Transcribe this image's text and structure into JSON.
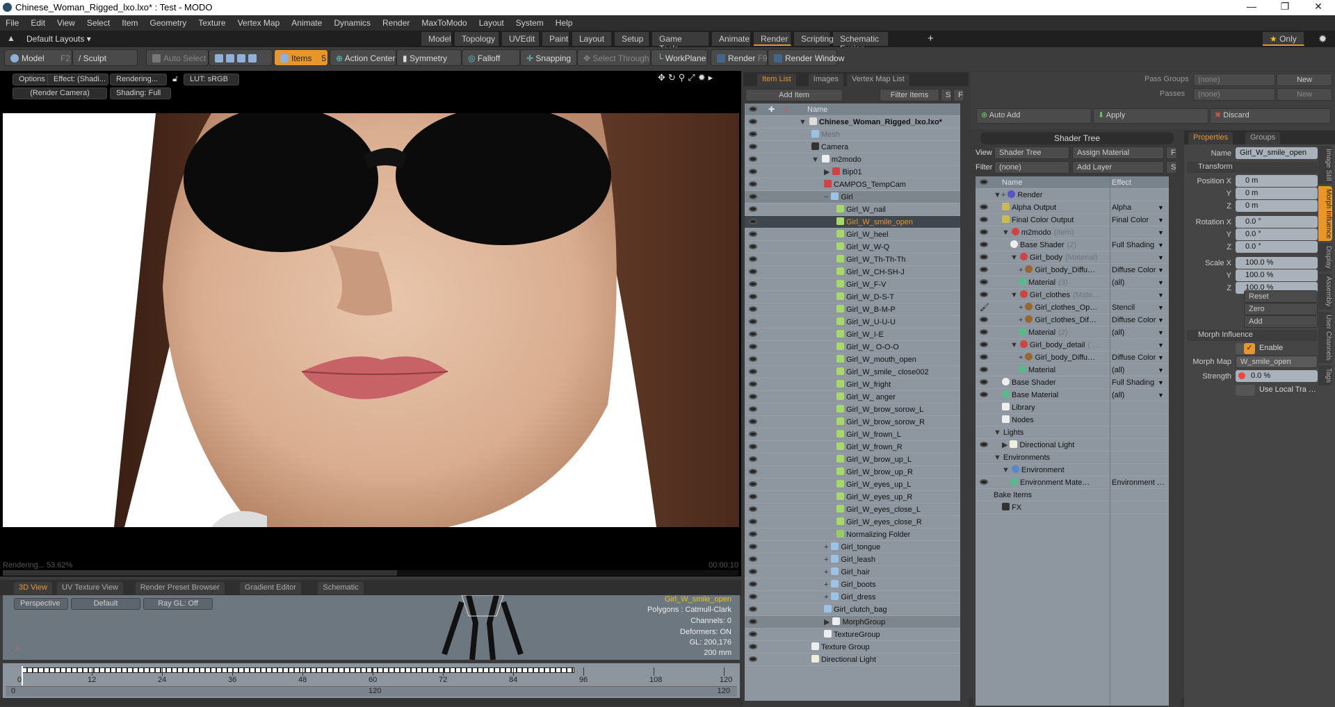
{
  "window": {
    "title": "Chinese_Woman_Rigged_lxo.lxo* : Test - MODO"
  },
  "menu": [
    "File",
    "Edit",
    "View",
    "Select",
    "Item",
    "Geometry",
    "Texture",
    "Vertex Map",
    "Animate",
    "Dynamics",
    "Render",
    "MaxToModo",
    "Layout",
    "System",
    "Help"
  ],
  "layouts": {
    "dropdown": "Default Layouts ▾",
    "tabs": [
      "Model",
      "Topology",
      "UVEdit",
      "Paint",
      "Layout",
      "Setup",
      "Game Tools",
      "Animate",
      "Render",
      "Scripting",
      "Schematic Fusion"
    ],
    "active": "Render",
    "only": "Only"
  },
  "toolbar": {
    "model": "Model",
    "model_key": "F2",
    "sculpt": "Sculpt",
    "auto_select": "Auto Select",
    "items": "Items",
    "items_key": "5",
    "action_center": "Action Center",
    "symmetry": "Symmetry",
    "falloff": "Falloff",
    "snapping": "Snapping",
    "select_through": "Select Through",
    "workplane": "WorkPlane",
    "render": "Render",
    "render_key": "F9",
    "render_window": "Render Window"
  },
  "viewport": {
    "options": "Options",
    "effect": "Effect: (Shadi...",
    "rendering": "Rendering...",
    "lut": "LUT: sRGB",
    "camera": "(Render Camera)",
    "shading": "Shading: Full",
    "status": "Rendering... 53.62%",
    "time": "00:00:10",
    "progress": 53.62
  },
  "bottom_tabs": [
    "3D View",
    "UV Texture View",
    "Render Preset Browser",
    "Gradient Editor",
    "Schematic"
  ],
  "view3d": {
    "perspective": "Perspective",
    "default": "Default",
    "raygl": "Ray GL: Off",
    "selected": "Girl_W_smile_open",
    "polygons": "Polygons : Catmull-Clark",
    "channels": "Channels: 0",
    "deformers": "Deformers: ON",
    "gl": "GL: 200,176",
    "scale": "200 mm"
  },
  "timeline": {
    "ticks": [
      "0",
      "12",
      "24",
      "36",
      "48",
      "60",
      "72",
      "84",
      "96",
      "108",
      "120"
    ],
    "range_start": "0",
    "range_mid": "120",
    "range_end": "120",
    "max": 120
  },
  "item_list": {
    "tabs": [
      "Item List",
      "Images",
      "Vertex Map List"
    ],
    "add_item": "Add Item",
    "filter": "Filter Items",
    "s": "S",
    "f": "F",
    "col_name": "Name",
    "rows": [
      {
        "label": "Chinese_Woman_Rigged_lxo.lxo*",
        "indent": 0,
        "icon": "scene",
        "exp": "▼",
        "bold": true
      },
      {
        "label": "Mesh",
        "indent": 1,
        "icon": "mesh",
        "dim": true
      },
      {
        "label": "Camera",
        "indent": 1,
        "icon": "camera"
      },
      {
        "label": "m2modo",
        "indent": 1,
        "icon": "folder",
        "exp": "▼"
      },
      {
        "label": "Bip01",
        "indent": 2,
        "icon": "locator",
        "exp": "▶"
      },
      {
        "label": "CAMPOS_TempCam",
        "indent": 2,
        "icon": "locator"
      },
      {
        "label": "Girl",
        "indent": 2,
        "icon": "mesh",
        "exp": "−",
        "grp": true
      },
      {
        "label": "Girl_W_nail",
        "indent": 3,
        "icon": "morph"
      },
      {
        "label": "Girl_W_smile_open",
        "indent": 3,
        "icon": "morph",
        "sel": true
      },
      {
        "label": "Girl_W_heel",
        "indent": 3,
        "icon": "morph"
      },
      {
        "label": "Girl_W_W-Q",
        "indent": 3,
        "icon": "morph"
      },
      {
        "label": "Girl_W_Th-Th-Th",
        "indent": 3,
        "icon": "morph"
      },
      {
        "label": "Girl_W_CH-SH-J",
        "indent": 3,
        "icon": "morph"
      },
      {
        "label": "Girl_W_F-V",
        "indent": 3,
        "icon": "morph"
      },
      {
        "label": "Girl_W_D-S-T",
        "indent": 3,
        "icon": "morph"
      },
      {
        "label": "Girl_W_B-M-P",
        "indent": 3,
        "icon": "morph"
      },
      {
        "label": "Girl_W_U-U-U",
        "indent": 3,
        "icon": "morph"
      },
      {
        "label": "Girl_W_I-E",
        "indent": 3,
        "icon": "morph"
      },
      {
        "label": "Girl_W_ O-O-O",
        "indent": 3,
        "icon": "morph"
      },
      {
        "label": "Girl_W_mouth_open",
        "indent": 3,
        "icon": "morph"
      },
      {
        "label": "Girl_W_smile_ close002",
        "indent": 3,
        "icon": "morph"
      },
      {
        "label": "Girl_W_fright",
        "indent": 3,
        "icon": "morph"
      },
      {
        "label": "Girl_W_ anger",
        "indent": 3,
        "icon": "morph"
      },
      {
        "label": "Girl_W_brow_sorow_L",
        "indent": 3,
        "icon": "morph"
      },
      {
        "label": "Girl_W_brow_sorow_R",
        "indent": 3,
        "icon": "morph"
      },
      {
        "label": "Girl_W_frown_L",
        "indent": 3,
        "icon": "morph"
      },
      {
        "label": "Girl_W_frown_R",
        "indent": 3,
        "icon": "morph"
      },
      {
        "label": "Girl_W_brow_up_L",
        "indent": 3,
        "icon": "morph"
      },
      {
        "label": "Girl_W_brow_up_R",
        "indent": 3,
        "icon": "morph"
      },
      {
        "label": "Girl_W_eyes_up_L",
        "indent": 3,
        "icon": "morph"
      },
      {
        "label": "Girl_W_eyes_up_R",
        "indent": 3,
        "icon": "morph"
      },
      {
        "label": "Girl_W_eyes_close_L",
        "indent": 3,
        "icon": "morph"
      },
      {
        "label": "Girl_W_eyes_close_R",
        "indent": 3,
        "icon": "morph"
      },
      {
        "label": "Normalizing Folder",
        "indent": 3,
        "icon": "folder2"
      },
      {
        "label": "Girl_tongue",
        "indent": 2,
        "icon": "mesh",
        "exp": "+"
      },
      {
        "label": "Girl_leash",
        "indent": 2,
        "icon": "mesh",
        "exp": "+"
      },
      {
        "label": "Girl_hair",
        "indent": 2,
        "icon": "mesh",
        "exp": "+"
      },
      {
        "label": "Girl_boots",
        "indent": 2,
        "icon": "mesh",
        "exp": "+"
      },
      {
        "label": "Girl_dress",
        "indent": 2,
        "icon": "mesh",
        "exp": "+"
      },
      {
        "label": "Girl_clutch_bag",
        "indent": 2,
        "icon": "mesh"
      },
      {
        "label": "MorphGroup",
        "indent": 2,
        "icon": "folder",
        "exp": "▶",
        "grp": true
      },
      {
        "label": "TextureGroup",
        "indent": 2,
        "icon": "folder"
      },
      {
        "label": "Texture Group",
        "indent": 1,
        "icon": "folder"
      },
      {
        "label": "Directional Light",
        "indent": 1,
        "icon": "light"
      }
    ]
  },
  "passes": {
    "pass_groups": "Pass Groups",
    "passes": "Passes",
    "none": "(none)",
    "new": "New",
    "auto_add": "Auto Add",
    "apply": "Apply",
    "discard": "Discard"
  },
  "shader_tree": {
    "title": "Shader Tree",
    "view_label": "View",
    "view": "Shader Tree",
    "assign": "Assign Material",
    "f": "F",
    "filter_label": "Filter",
    "filter": "(none)",
    "add_layer": "Add Layer",
    "s": "S",
    "col_name": "Name",
    "col_effect": "Effect",
    "rows": [
      {
        "name": "Render",
        "indent": 0,
        "icon": "render",
        "exp": "▼+",
        "eye": false
      },
      {
        "name": "Alpha Output",
        "indent": 1,
        "icon": "output",
        "effect": "Alpha",
        "eye": true
      },
      {
        "name": "Final Color Output",
        "indent": 1,
        "icon": "output",
        "effect": "Final Color",
        "eye": true
      },
      {
        "name": "m2modo",
        "suffix": "(Item)",
        "indent": 1,
        "icon": "mask",
        "exp": "▼",
        "eye": true
      },
      {
        "name": "Base Shader",
        "suffix": "(2)",
        "indent": 2,
        "icon": "shader",
        "effect": "Full Shading",
        "eye": true
      },
      {
        "name": "Girl_body",
        "suffix": "(Material)",
        "indent": 2,
        "icon": "mask",
        "exp": "▼",
        "eye": true
      },
      {
        "name": "Girl_body_Diffu…",
        "indent": 3,
        "icon": "texture",
        "exp": "+",
        "effect": "Diffuse Color",
        "eye": true
      },
      {
        "name": "Material",
        "suffix": "(3)",
        "indent": 3,
        "icon": "material",
        "effect": "(all)",
        "eye": true
      },
      {
        "name": "Girl_clothes",
        "suffix": "(Mate…",
        "indent": 2,
        "icon": "mask",
        "exp": "▼",
        "eye": true
      },
      {
        "name": "Girl_clothes_Op…",
        "indent": 3,
        "icon": "texture",
        "exp": "+",
        "effect": "Stencil",
        "eye": "brush"
      },
      {
        "name": "Girl_clothes_Dif…",
        "indent": 3,
        "icon": "texture",
        "exp": "+",
        "effect": "Diffuse Color",
        "eye": true
      },
      {
        "name": "Material",
        "suffix": "(2)",
        "indent": 3,
        "icon": "material",
        "effect": "(all)",
        "eye": true
      },
      {
        "name": "Girl_body_detail",
        "suffix": "( …",
        "indent": 2,
        "icon": "mask",
        "exp": "▼",
        "eye": true
      },
      {
        "name": "Girl_body_Diffu…",
        "indent": 3,
        "icon": "texture",
        "exp": "+",
        "effect": "Diffuse Color",
        "eye": true
      },
      {
        "name": "Material",
        "indent": 3,
        "icon": "material",
        "effect": "(all)",
        "eye": true
      },
      {
        "name": "Base Shader",
        "indent": 1,
        "icon": "shader",
        "effect": "Full Shading",
        "eye": true
      },
      {
        "name": "Base Material",
        "indent": 1,
        "icon": "material",
        "effect": "(all)",
        "eye": true
      },
      {
        "name": "Library",
        "indent": 1,
        "icon": "folder",
        "eye": false
      },
      {
        "name": "Nodes",
        "indent": 1,
        "icon": "folder",
        "eye": false
      },
      {
        "name": "Lights",
        "indent": 0,
        "exp": "▼",
        "eye": false
      },
      {
        "name": "Directional Light",
        "indent": 1,
        "icon": "light",
        "exp": "▶",
        "eye": true
      },
      {
        "name": "Environments",
        "indent": 0,
        "exp": "▼",
        "eye": false
      },
      {
        "name": "Environment",
        "indent": 1,
        "icon": "env",
        "exp": "▼",
        "eye": false
      },
      {
        "name": "Environment Mate…",
        "indent": 2,
        "icon": "material",
        "effect": "Environment  …",
        "eye": true
      },
      {
        "name": "Bake Items",
        "indent": 0,
        "eye": false
      },
      {
        "name": "FX",
        "indent": 1,
        "icon": "fx",
        "eye": false
      }
    ]
  },
  "properties": {
    "tabs": [
      "Properties",
      "Groups"
    ],
    "name_label": "Name",
    "name": "Girl_W_smile_open",
    "transform": "Transform",
    "fields": [
      {
        "label": "Position X",
        "value": "0 m"
      },
      {
        "label": "Y",
        "value": "0 m"
      },
      {
        "label": "Z",
        "value": "0 m"
      },
      {
        "label": "Rotation X",
        "value": "0.0 °"
      },
      {
        "label": "Y",
        "value": "0.0 °"
      },
      {
        "label": "Z",
        "value": "0.0 °"
      },
      {
        "label": "Scale X",
        "value": "100.0 %"
      },
      {
        "label": "Y",
        "value": "100.0 %"
      },
      {
        "label": "Z",
        "value": "100.0 %"
      }
    ],
    "reset": "Reset",
    "zero": "Zero",
    "add": "Add",
    "morph_section": "Morph Influence",
    "enable": "Enable",
    "morph_map_label": "Morph Map",
    "morph_map": "W_smile_open",
    "strength_label": "Strength",
    "strength": "0.0 %",
    "use_local": "Use Local Tra …",
    "side_tabs": [
      "Image Still",
      "Morph Influence",
      "Display",
      "Assembly",
      "User Channels",
      "Tags"
    ]
  },
  "colors": {
    "accent": "#e8962a",
    "list_bg": "#8e979f",
    "selected_row": "#3f464d"
  }
}
